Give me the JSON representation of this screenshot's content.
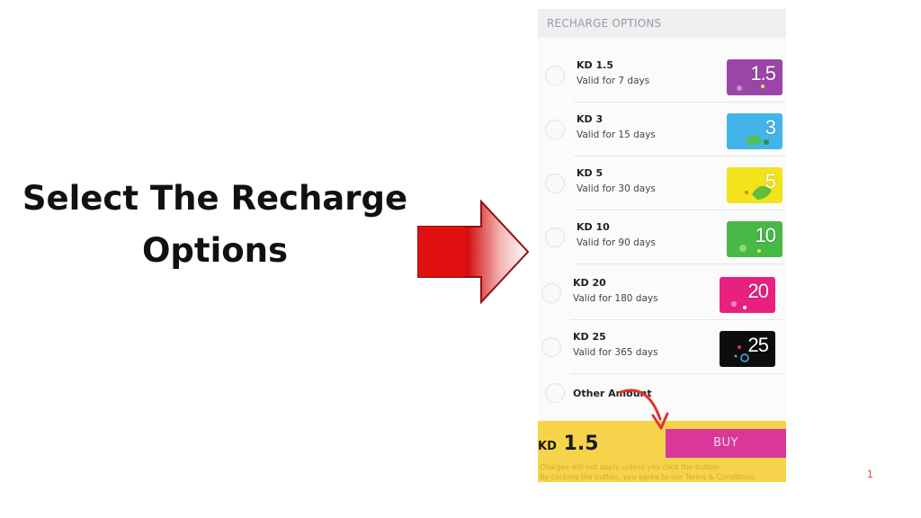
{
  "heading": {
    "line1": "Select The Recharge",
    "line2": "Options"
  },
  "app": {
    "section_title": "RECHARGE OPTIONS",
    "options": [
      {
        "title": "KD 1.5",
        "validity": "Valid for 7 days",
        "card_number": "1.5",
        "card_color": "#9b45a8"
      },
      {
        "title": "KD 3",
        "validity": "Valid for 15 days",
        "card_number": "3",
        "card_color": "#43b4ea"
      },
      {
        "title": "KD 5",
        "validity": "Valid for 30 days",
        "card_number": "5",
        "card_color": "#f2e31c"
      },
      {
        "title": "KD 10",
        "validity": "Valid for 90 days",
        "card_number": "10",
        "card_color": "#48b946"
      },
      {
        "title": "KD 20",
        "validity": "Valid for 180 days",
        "card_number": "20",
        "card_color": "#e8207f"
      },
      {
        "title": "KD 25",
        "validity": "Valid for 365 days",
        "card_number": "25",
        "card_color": "#0d0d0d"
      }
    ],
    "other_amount_label": "Other Amount",
    "total": {
      "currency": "KD",
      "amount": "1.5"
    },
    "buy_label": "BUY",
    "fine_print": [
      "Charges will not apply unless you click the button",
      "By clicking the button, you agree to our Terms & Conditions"
    ]
  },
  "page_number": "1",
  "colors": {
    "arrow_red": "#e21212",
    "footer_yellow": "#f6d34a",
    "buy_pink": "#d9389a",
    "annotation_red": "#e03232"
  }
}
